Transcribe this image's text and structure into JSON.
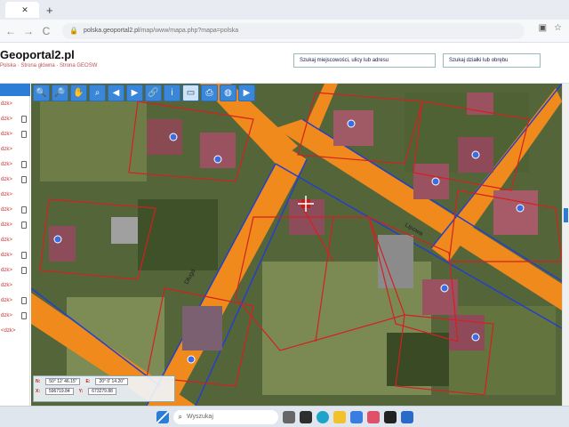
{
  "browser": {
    "tab_title": "",
    "new_tab": "+",
    "back": "←",
    "forward": "→",
    "reload": "C",
    "url_host": "polska.geoportal2.pl",
    "url_path": "/map/www/mapa.php?mapa=polska"
  },
  "header": {
    "logo": "Geoportal2.pl",
    "breadcrumb": "Polska · Strona główna · Strona GEOSW",
    "btn_address": "Szukaj miejscowości, ulicy lub adresu",
    "btn_parcel": "Szukaj działki lub obrębu"
  },
  "sidebar": {
    "items": [
      {
        "label": "dzk>"
      },
      {
        "label": "dzk>"
      },
      {
        "label": "dzk>"
      },
      {
        "label": "dzk>"
      },
      {
        "label": "dzk>"
      },
      {
        "label": "dzk>"
      },
      {
        "label": "dzk>"
      },
      {
        "label": "dzk>"
      },
      {
        "label": "dzk>"
      },
      {
        "label": "dzk>"
      },
      {
        "label": "dzk>"
      },
      {
        "label": "dzk>"
      },
      {
        "label": "dzk>"
      },
      {
        "label": "dzk>"
      },
      {
        "label": "dzk>"
      },
      {
        "label": "<dzk>"
      }
    ]
  },
  "map": {
    "coords": {
      "lat_label": "N:",
      "lat": "50° 12' 46.15\"",
      "lon_label": "E:",
      "lon": "20° 0' 14.20\"",
      "x_label": "X:",
      "x": "596719.84",
      "y_label": "Y:",
      "y": "673279.88"
    },
    "road_label_1": "Długa",
    "road_label_2": "Lipowa"
  },
  "taskbar": {
    "search_placeholder": "Wyszukaj"
  },
  "colors": {
    "accent": "#2b7dd6",
    "road": "#f08a1c",
    "parcel": "#d42020"
  }
}
